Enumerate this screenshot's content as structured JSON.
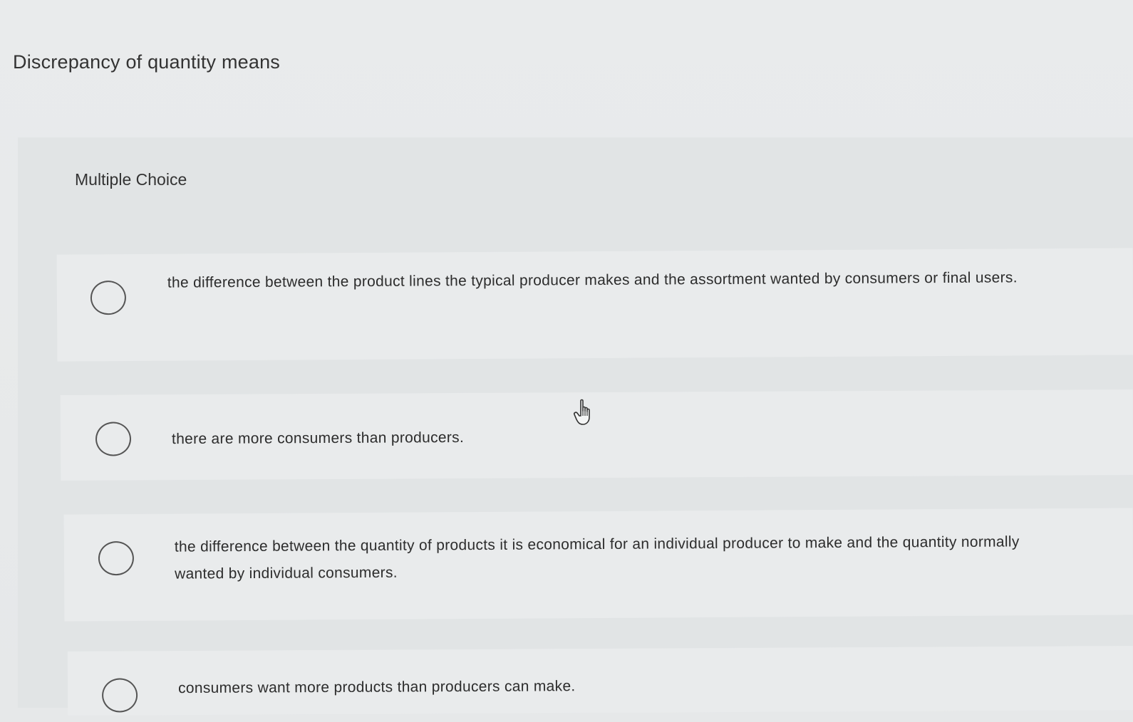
{
  "question": {
    "title": "Discrepancy of quantity means"
  },
  "panel": {
    "label": "Multiple Choice"
  },
  "options": [
    {
      "text": "the difference between the product lines the typical producer makes and the assortment wanted by consumers or final users.",
      "selected": false
    },
    {
      "text": "there are more consumers than producers.",
      "selected": false
    },
    {
      "text": "the difference between the quantity of products it is economical for an individual producer to make and the quantity normally wanted by individual consumers.",
      "selected": false
    },
    {
      "text": "consumers want more products than producers can make.",
      "selected": false
    }
  ],
  "icons": {
    "radio": "radio-unselected-icon",
    "cursor": "hand-pointer-icon"
  }
}
